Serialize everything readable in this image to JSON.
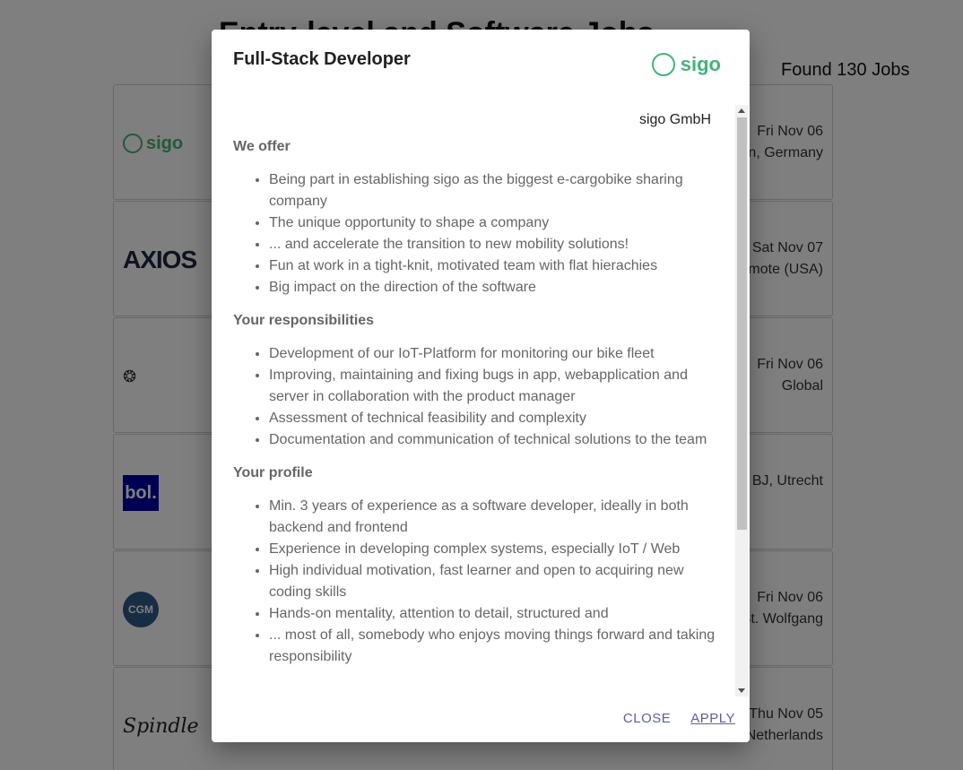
{
  "page": {
    "title": "Entry-level and Software Jobs",
    "found": "Found 130 Jobs"
  },
  "jobs": [
    {
      "logo": "sigo",
      "meta1": "Fri Nov 06",
      "meta2": "Berlin, Germany"
    },
    {
      "logo": "AXIOS",
      "meta1": "Sat Nov 07",
      "meta2": "Remote (USA)"
    },
    {
      "logo": "wenus-icon",
      "meta1": "Fri Nov 06",
      "meta2": "Global"
    },
    {
      "logo": "bol.",
      "meta1": "",
      "meta2": "BJ, Utrecht"
    },
    {
      "logo": "CGM",
      "meta1": "Fri Nov 06",
      "meta2": "St. Wolfgang"
    },
    {
      "logo": "Spindle",
      "meta1": "Thu Nov 05",
      "meta2": "Netherlands"
    }
  ],
  "dialog": {
    "title": "Full-Stack Developer",
    "logo_text": "sigo",
    "company": "sigo GmbH",
    "sections": [
      {
        "heading": "We offer",
        "items": [
          "Being part in establishing sigo as the biggest e-cargobike sharing company",
          "The unique opportunity to shape a company",
          "... and accelerate the transition to new mobility solutions!",
          "Fun at work in a tight-knit, motivated team with flat hierachies",
          "Big impact on the direction of the software"
        ]
      },
      {
        "heading": "Your responsibilities",
        "items": [
          "Development of our IoT-Platform for monitoring our bike fleet",
          "Improving, maintaining and fixing bugs in app, webapplication and server in collaboration with the product manager",
          "Assessment of technical feasibility and complexity",
          "Documentation and communication of technical solutions to the team"
        ]
      },
      {
        "heading": "Your profile",
        "items": [
          "Min. 3 years of experience as a software developer, ideally in both backend and frontend",
          "Experience in developing complex systems, especially IoT / Web",
          "High individual motivation, fast learner and open to acquiring new coding skills",
          "Hands-on mentality, attention to detail, structured and",
          "... most of all, somebody who enjoys moving things forward and taking responsibility"
        ]
      }
    ],
    "close_label": "CLOSE",
    "apply_label": "APPLY"
  },
  "colors": {
    "brand_green": "#43b37a",
    "button_text": "#5b5fa8"
  }
}
